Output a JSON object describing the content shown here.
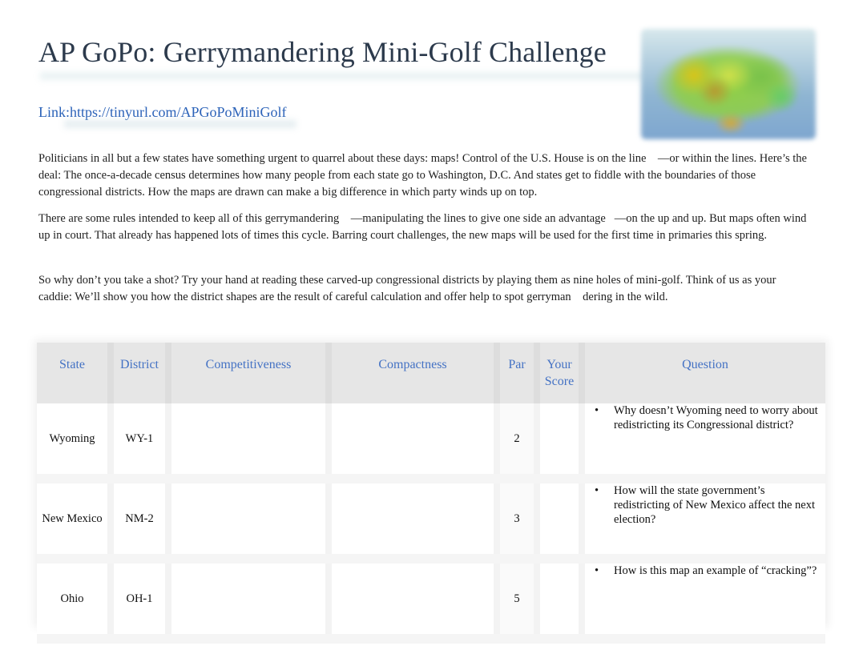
{
  "header": {
    "title": "AP GoPo: Gerrymandering Mini-Golf Challenge",
    "link_text": "Link:https://tinyurl.com/APGoPoMiniGolf",
    "image_alt": "US map image"
  },
  "intro": {
    "paragraphs": [
      "Politicians in all but a few states have something urgent to quarrel about these days: maps! Control of the U.S. House is on the line    —or within the lines. Here’s the deal: The once-a-decade census determines how many people from each state go to Washington, D.C. And states get to fiddle with the boundaries of those congressional districts. How the maps are drawn can make a big difference in which party winds up on top.",
      "There are some rules intended to keep all of this gerrymandering    —manipulating the lines to give one side an advantage   —on the up and up. But maps often wind up in court. That already has happened lots of times this cycle. Barring court challenges, the new maps will be used for the first time in primaries this spring.",
      "So why don’t you take a shot? Try your hand at reading these carved-up congressional districts by playing them as nine holes of mini-golf. Think of us as your caddie: We’ll show you how the district shapes are the result of careful calculation and offer help to spot gerryman    dering in the wild."
    ]
  },
  "table": {
    "headers": [
      "State",
      "District",
      "Competitiveness",
      "Compactness",
      "Par",
      "Your Score",
      "Question"
    ],
    "rows": [
      {
        "state": "Wyoming",
        "district": "WY-1",
        "competitiveness": "",
        "compactness": "",
        "par": "2",
        "score": "",
        "question": "Why doesn’t Wyoming need to worry about redistricting its Congressional district?"
      },
      {
        "state": "New Mexico",
        "district": "NM-2",
        "competitiveness": "",
        "compactness": "",
        "par": "3",
        "score": "",
        "question": "How will the state government’s redistricting of New Mexico affect the next election?"
      },
      {
        "state": "Ohio",
        "district": "OH-1",
        "competitiveness": "",
        "compactness": "",
        "par": "5",
        "score": "",
        "question": "How is this map an example of “cracking”?"
      }
    ],
    "bullet": "•"
  },
  "colors": {
    "title": "#2c3a4c",
    "link": "#2a62b8",
    "header_text": "#4472c4",
    "header_bg": "#e6e6e6"
  }
}
